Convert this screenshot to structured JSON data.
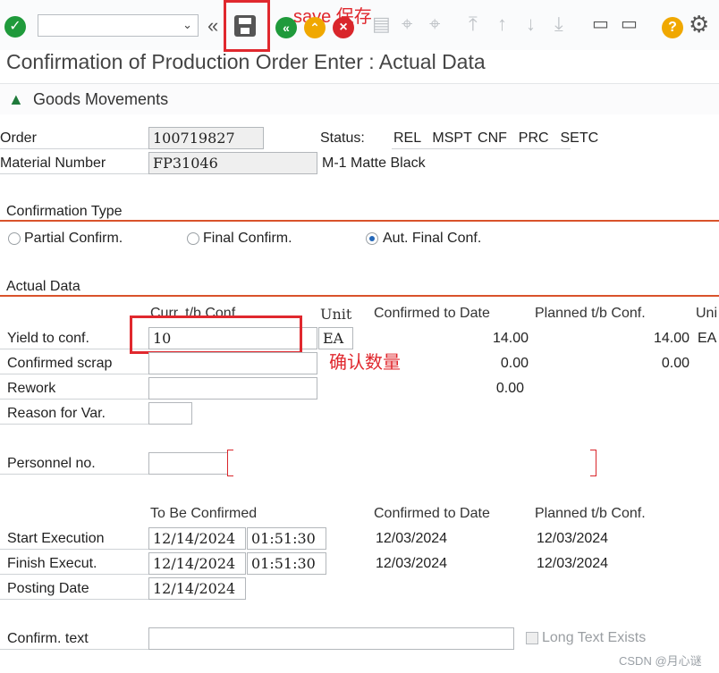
{
  "toolbar": {
    "command_value": "",
    "save_annotation": "save 保存"
  },
  "screen_title": "Confirmation of Production Order Enter : Actual Data",
  "goods_movements": "Goods Movements",
  "header": {
    "order_label": "Order",
    "order_value": "100719827",
    "status_label": "Status:",
    "status_values": "REL  MSPT CNF  PRC  SETC",
    "material_label": "Material Number",
    "material_value": "FP31046",
    "material_desc": "M-1 Matte Black"
  },
  "confirmation_type": {
    "heading": "Confirmation Type",
    "partial": "Partial Confirm.",
    "final": "Final Confirm.",
    "auto": "Aut. Final Conf."
  },
  "actual_data": {
    "heading": "Actual Data",
    "col_curr": "Curr. t/b Conf.",
    "col_unit": "Unit",
    "col_confirmed": "Confirmed to Date",
    "col_planned": "Planned t/b Conf.",
    "col_unit2": "Uni",
    "yield_label": "Yield to conf.",
    "yield_value": "10",
    "yield_unit": "EA",
    "yield_confirmed": "14.00",
    "yield_planned": "14.00",
    "yield_planned_unit": "EA",
    "scrap_label": "Confirmed scrap",
    "scrap_confirmed": "0.00",
    "scrap_planned": "0.00",
    "rework_label": "Rework",
    "rework_confirmed": "0.00",
    "reason_label": "Reason for Var.",
    "personnel_label": "Personnel no.",
    "annotation_qty": "确认数量"
  },
  "dates": {
    "col_tbc": "To Be Confirmed",
    "col_confirmed": "Confirmed to Date",
    "col_planned": "Planned t/b Conf.",
    "start_label": "Start Execution",
    "start_date": "12/14/2024",
    "start_time": "01:51:30",
    "start_confirmed": "12/03/2024",
    "start_planned": "12/03/2024",
    "finish_label": "Finish Execut.",
    "finish_date": "12/14/2024",
    "finish_time": "01:51:30",
    "finish_confirmed": "12/03/2024",
    "finish_planned": "12/03/2024",
    "posting_label": "Posting Date",
    "posting_date": "12/14/2024"
  },
  "footer": {
    "confirm_text_label": "Confirm. text",
    "long_text": "Long Text Exists",
    "watermark": "CSDN @月心谜"
  },
  "colors": {
    "accent_red": "#e0282e",
    "section_line": "#d9532b",
    "ok_green": "#1f9a3b"
  }
}
